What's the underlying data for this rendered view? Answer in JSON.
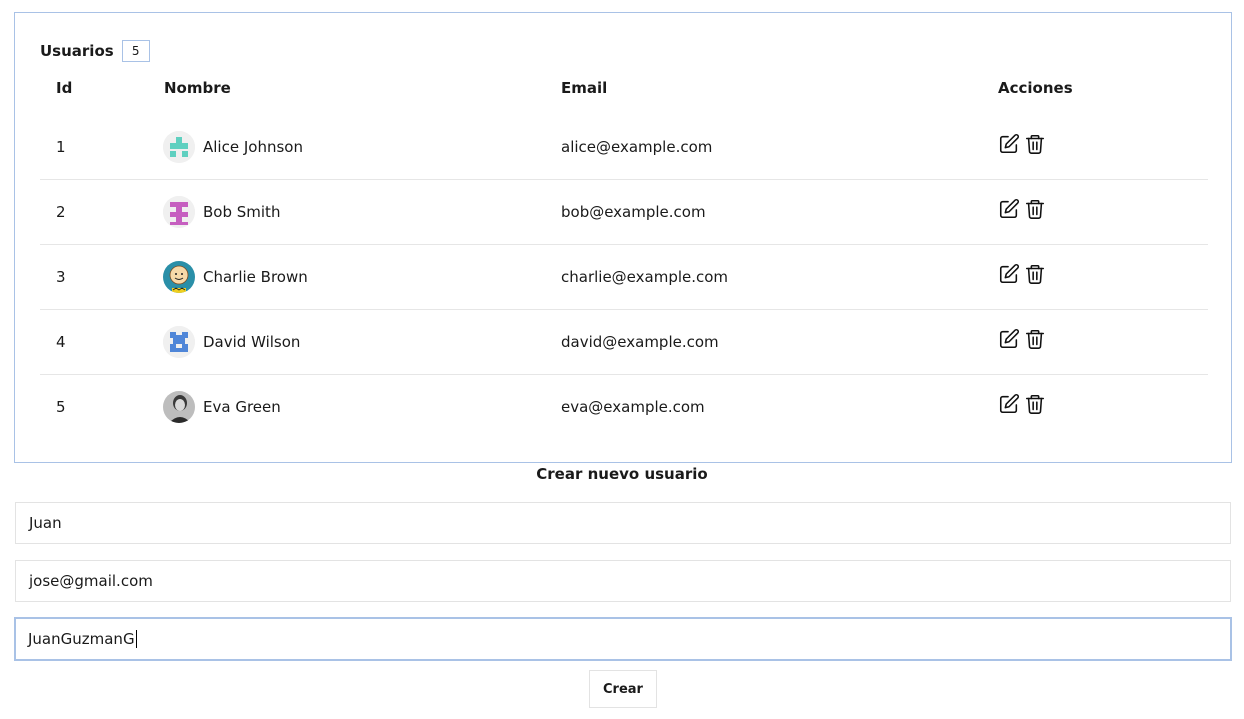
{
  "users_panel": {
    "title": "Usuarios",
    "count": "5",
    "columns": {
      "id": "Id",
      "name": "Nombre",
      "email": "Email",
      "actions": "Acciones"
    },
    "rows": [
      {
        "id": "1",
        "name": "Alice Johnson",
        "email": "alice@example.com",
        "avatar": "identicon-teal"
      },
      {
        "id": "2",
        "name": "Bob Smith",
        "email": "bob@example.com",
        "avatar": "identicon-magenta"
      },
      {
        "id": "3",
        "name": "Charlie Brown",
        "email": "charlie@example.com",
        "avatar": "cartoon-charlie"
      },
      {
        "id": "4",
        "name": "David Wilson",
        "email": "david@example.com",
        "avatar": "identicon-blue"
      },
      {
        "id": "5",
        "name": "Eva Green",
        "email": "eva@example.com",
        "avatar": "photo-portrait"
      }
    ],
    "row_actions": [
      "edit-icon",
      "trash-icon"
    ]
  },
  "create_form": {
    "title": "Crear nuevo usuario",
    "name_value": "Juan",
    "email_value": "jose@gmail.com",
    "username_value": "JuanGuzmanG",
    "submit_label": "Crear"
  },
  "colors": {
    "border_accent": "#a9c2e6",
    "row_divider": "#e6e6e6",
    "text": "#1a1a1a"
  }
}
